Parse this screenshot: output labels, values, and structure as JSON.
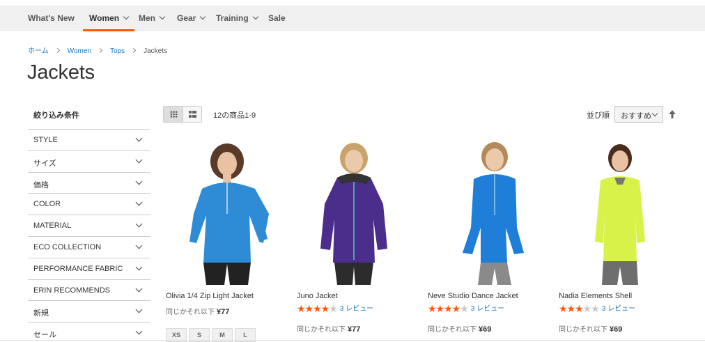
{
  "nav": {
    "items": [
      {
        "label": "What's New"
      },
      {
        "label": "Women"
      },
      {
        "label": "Men"
      },
      {
        "label": "Gear"
      },
      {
        "label": "Training"
      },
      {
        "label": "Sale"
      }
    ]
  },
  "breadcrumb": {
    "home": "ホーム",
    "women": "Women",
    "tops": "Tops",
    "current": "Jackets"
  },
  "page_title": "Jackets",
  "sidebar": {
    "title": "絞り込み条件",
    "filters": [
      "STYLE",
      "サイズ",
      "価格",
      "COLOR",
      "MATERIAL",
      "ECO COLLECTION",
      "PERFORMANCE FABRIC",
      "ERIN RECOMMENDS",
      "新規",
      "セール"
    ]
  },
  "toolbar": {
    "amount": "12の商品1-9",
    "sort_label": "並び順",
    "sort_value": "おすすめ",
    "view_modes": [
      "grid-view-icon",
      "list-view-icon"
    ]
  },
  "products": [
    {
      "name": "Olivia 1/4 Zip Light Jacket",
      "price_prefix": "同じかそれ以下",
      "price": "¥77",
      "rating": null,
      "reviews": null,
      "sizes": [
        "XS",
        "S",
        "M",
        "L"
      ],
      "color": "#2e8bd6"
    },
    {
      "name": "Juno Jacket",
      "price_prefix": "同じかそれ以下",
      "price": "¥77",
      "rating": 4,
      "reviews": "3 レビュー",
      "color": "#4b2d8c"
    },
    {
      "name": "Neve Studio Dance Jacket",
      "price_prefix": "同じかそれ以下",
      "price": "¥69",
      "rating": 4,
      "reviews": "3 レビュー",
      "color": "#1f7fd8"
    },
    {
      "name": "Nadia Elements Shell",
      "price_prefix": "同じかそれ以下",
      "price": "¥69",
      "rating": 3,
      "reviews": "3 レビュー",
      "color": "#d9f24a"
    }
  ],
  "colors": {
    "accent": "#ff5501",
    "link": "#1979c3",
    "nav_bg": "#f0f0f0"
  }
}
